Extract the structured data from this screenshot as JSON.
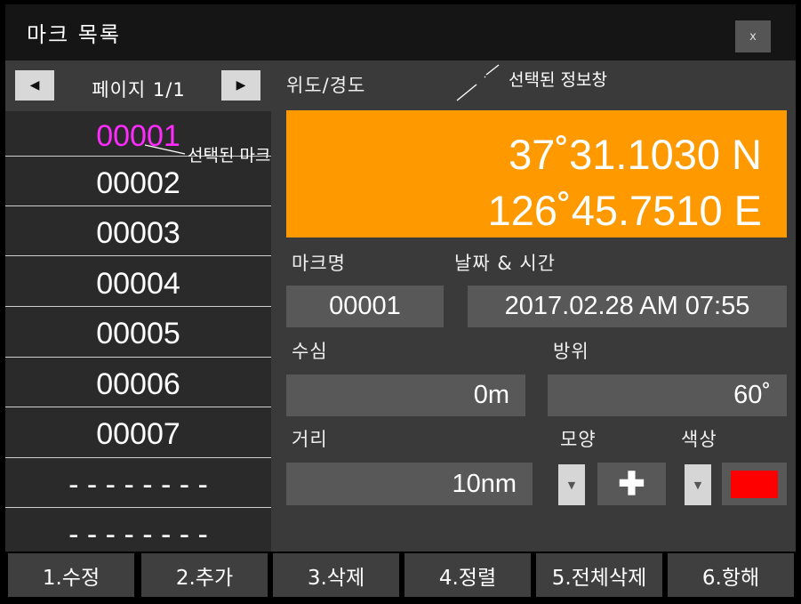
{
  "window": {
    "title": "마크 목록",
    "close_label": "x"
  },
  "pager": {
    "prev_icon": "◀",
    "next_icon": "▶",
    "text": "페이지 1/1"
  },
  "marks": [
    "00001",
    "00002",
    "00003",
    "00004",
    "00005",
    "00006",
    "00007",
    "- - - - - - - -",
    "- - - - - - - -"
  ],
  "annotations": {
    "selected_info": "선택된 정보창",
    "selected_mark": "선택된 마크"
  },
  "info": {
    "latlon_label": "위도/경도",
    "lat": "37˚31.1030 N",
    "lon": "126˚45.7510 E",
    "name_label": "마크명",
    "datetime_label": "날짜 & 시간",
    "name_value": "00001",
    "datetime_value": "2017.02.28 AM 07:55",
    "depth_label": "수심",
    "bearing_label": "방위",
    "depth_value": "0m",
    "bearing_value": "60˚",
    "distance_label": "거리",
    "shape_label": "모양",
    "color_label": "색상",
    "distance_value": "10nm",
    "shape_symbol": "✚",
    "color_value": "#ff0000"
  },
  "buttons": [
    "1.수정",
    "2.추가",
    "3.삭제",
    "4.정렬",
    "5.전체삭제",
    "6.항해"
  ],
  "colors": {
    "accent": "#ff9900",
    "selected_mark": "#ff2bff"
  }
}
